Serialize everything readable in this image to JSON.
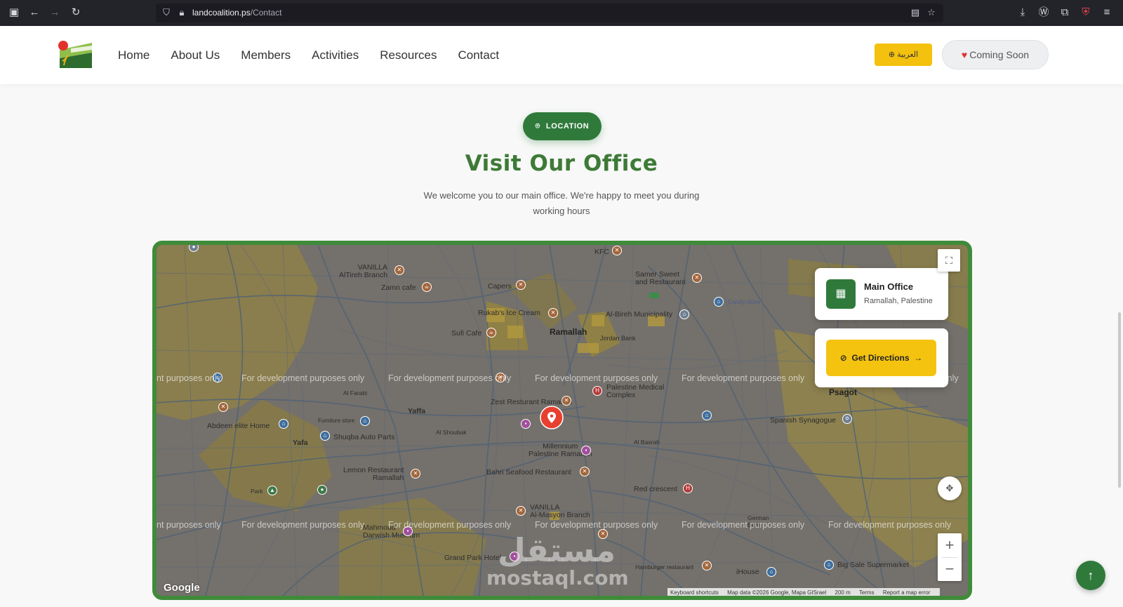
{
  "browser": {
    "url_host": "landcoalition.ps",
    "url_path": "/Contact",
    "back_icon": "arrow-left-icon",
    "forward_icon": "arrow-right-icon",
    "reload_icon": "reload-icon"
  },
  "nav": {
    "items": [
      "Home",
      "About Us",
      "Members",
      "Activities",
      "Resources",
      "Contact"
    ],
    "lang_button": "العربية",
    "coming_soon": "Coming Soon"
  },
  "section": {
    "badge": "LOCATION",
    "title": "Visit Our Office",
    "subtitle": "We welcome you to our main office. We're happy to meet you during working hours"
  },
  "office_card": {
    "name": "Main Office",
    "location": "Ramallah, Palestine"
  },
  "directions": {
    "label": "Get Directions"
  },
  "map": {
    "dev_watermark": "For development purposes only",
    "dev_watermark_partial_left": "nt purposes only",
    "dev_watermark_partial_right": "s only",
    "labels": {
      "ramallah": "Ramallah",
      "psagot": "Psagot",
      "yaffa": "Yaffa",
      "yafa": "Yafa",
      "vanilla_altireh": "VANILLA\nAlTireh Branch",
      "zamn": "Zamn cafe",
      "capers": "Capers",
      "kfc": "KFC",
      "samer": "Samer Sweet\nand Restaurant",
      "rukab": "Rukab's Ice Cream",
      "albireh": "Al-Bireh Municipality",
      "jordan_bank": "Jordan Bank",
      "sufi": "Sufi Cafe",
      "candy": "Candy store",
      "zest": "Zest Resturant Ramallah",
      "palestine_medical": "Palestine Medical\nComplex",
      "abdeen": "Abdeen elite Home",
      "shuqba": "Shuqba Auto Parts",
      "furniture": "Furniture store",
      "spanish": "Spanish Synagogue",
      "millennium": "Millennium\nPalestine Ramallah",
      "bahri": "Bahri Seafood Restaurant",
      "lemon": "Lemon Restaurant\nRamallah",
      "red_crescent": "Red crescent",
      "vanilla_masyon": "VANILLA\nAl-Masyon Branch",
      "mahmoud": "Mahmoud\nDarwish Museum",
      "grand_park": "Grand Park Hotel",
      "hamburger": "Hamburger restaurant",
      "ihouse": "iHouse",
      "big_sale": "Big Sale Supermarket",
      "park": "Park",
      "german_bank": "German\nBank",
      "al_farabi": "Al Farabi",
      "al_basrah": "Al Basrah",
      "al_shoubak": "Al Shoubak"
    },
    "google": "Google",
    "attribution": [
      "Keyboard shortcuts",
      "Map data ©2026 Google, Mapa GISrael",
      "200 m",
      "Terms",
      "Report a map error"
    ],
    "marker_color": "#e8402f"
  },
  "watermark": {
    "arabic": "مستقل",
    "latin": "mostaql.com"
  },
  "colors": {
    "brand_green": "#2f7a3b",
    "title_green": "#3e7a37",
    "accent_yellow": "#f3c10e"
  }
}
